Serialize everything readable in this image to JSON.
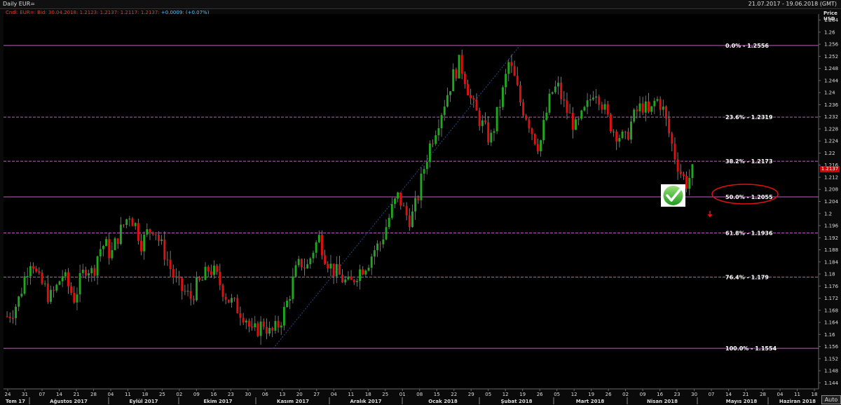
{
  "window": {
    "title": "Daily EUR=",
    "date_range": "21.07.2017 - 19.06.2018 (GMT)"
  },
  "info_bar": {
    "ohlc": "Cndl; EUR=; Bid; 30.04.2018; 1.2123; 1.2137; 1.2117; 1.2137;",
    "change": "+0.0009; (+0.07%)"
  },
  "y_axis_title_line1": "Price",
  "y_axis_title_line2": "USD",
  "last_price_label": "1.2137",
  "auto_button": "Auto",
  "colors": {
    "up": "#1fa81f",
    "down": "#e01010",
    "fib_line": "#c060c0",
    "background": "#000000"
  },
  "chart_data": {
    "type": "candlestick",
    "ylim": [
      1.142,
      1.266
    ],
    "y_ticks": [
      "1.264",
      "1.26",
      "1.256",
      "1.252",
      "1.248",
      "1.244",
      "1.24",
      "1.236",
      "1.232",
      "1.228",
      "1.224",
      "1.22",
      "1.216",
      "1.212",
      "1.208",
      "1.204",
      "1.2",
      "1.196",
      "1.192",
      "1.188",
      "1.184",
      "1.18",
      "1.176",
      "1.172",
      "1.168",
      "1.164",
      "1.16",
      "1.156",
      "1.152",
      "1.148",
      "1.144"
    ],
    "x_day_ticks": [
      "24",
      "31",
      "07",
      "14",
      "21",
      "28",
      "04",
      "11",
      "18",
      "25",
      "02",
      "09",
      "16",
      "23",
      "30",
      "06",
      "13",
      "20",
      "27",
      "04",
      "11",
      "18",
      "25",
      "01",
      "08",
      "15",
      "22",
      "29",
      "05",
      "12",
      "19",
      "26",
      "05",
      "12",
      "19",
      "26",
      "02",
      "09",
      "16",
      "23",
      "30",
      "07",
      "14",
      "21",
      "28",
      "04",
      "11",
      "18"
    ],
    "x_month_labels": [
      "Tem 17",
      "Ağustos 2017",
      "Eylül 2017",
      "Ekim 2017",
      "Kasım 2017",
      "Aralık 2017",
      "Ocak 2018",
      "Şubat 2018",
      "Mart 2018",
      "Nisan 2018",
      "Mayıs 2018",
      "Haziran 2018"
    ],
    "fibonacci": [
      {
        "level": "0.0%",
        "price": 1.2556,
        "label": "0.0% - 1.2556",
        "style": "solid"
      },
      {
        "level": "23.6%",
        "price": 1.2319,
        "label": "23.6% - 1.2319",
        "style": "dashed"
      },
      {
        "level": "38.2%",
        "price": 1.2173,
        "label": "38.2% - 1.2173",
        "style": "dashed"
      },
      {
        "level": "50.0%",
        "price": 1.2055,
        "label": "50.0% - 1.2055",
        "style": "solid"
      },
      {
        "level": "61.8%",
        "price": 1.1936,
        "label": "61.8% - 1.1936",
        "style": "dashed"
      },
      {
        "level": "76.4%",
        "price": 1.179,
        "label": "76.4% - 1.179",
        "style": "dashed"
      },
      {
        "level": "100.0%",
        "price": 1.1554,
        "label": "100.0% - 1.1554",
        "style": "solid"
      }
    ],
    "trendline": {
      "from_price": 1.1554,
      "to_price": 1.2556
    },
    "path_closes": [
      1.166,
      1.168,
      1.172,
      1.18,
      1.186,
      1.178,
      1.176,
      1.172,
      1.175,
      1.18,
      1.176,
      1.172,
      1.178,
      1.183,
      1.18,
      1.188,
      1.19,
      1.186,
      1.192,
      1.196,
      1.2,
      1.196,
      1.19,
      1.194,
      1.196,
      1.19,
      1.186,
      1.18,
      1.176,
      1.174,
      1.172,
      1.176,
      1.178,
      1.182,
      1.18,
      1.176,
      1.172,
      1.17,
      1.168,
      1.166,
      1.16,
      1.162,
      1.164,
      1.16,
      1.162,
      1.166,
      1.172,
      1.18,
      1.184,
      1.182,
      1.188,
      1.192,
      1.186,
      1.182,
      1.18,
      1.178,
      1.176,
      1.18,
      1.182,
      1.184,
      1.188,
      1.19,
      1.196,
      1.202,
      1.206,
      1.2,
      1.198,
      1.204,
      1.214,
      1.222,
      1.228,
      1.234,
      1.24,
      1.246,
      1.25,
      1.244,
      1.236,
      1.232,
      1.228,
      1.224,
      1.232,
      1.24,
      1.25,
      1.244,
      1.236,
      1.232,
      1.226,
      1.222,
      1.232,
      1.24,
      1.242,
      1.236,
      1.232,
      1.228,
      1.232,
      1.236,
      1.242,
      1.238,
      1.232,
      1.228,
      1.226,
      1.224,
      1.23,
      1.234,
      1.236,
      1.232,
      1.238,
      1.236,
      1.228,
      1.22,
      1.214,
      1.21,
      1.2137
    ]
  }
}
